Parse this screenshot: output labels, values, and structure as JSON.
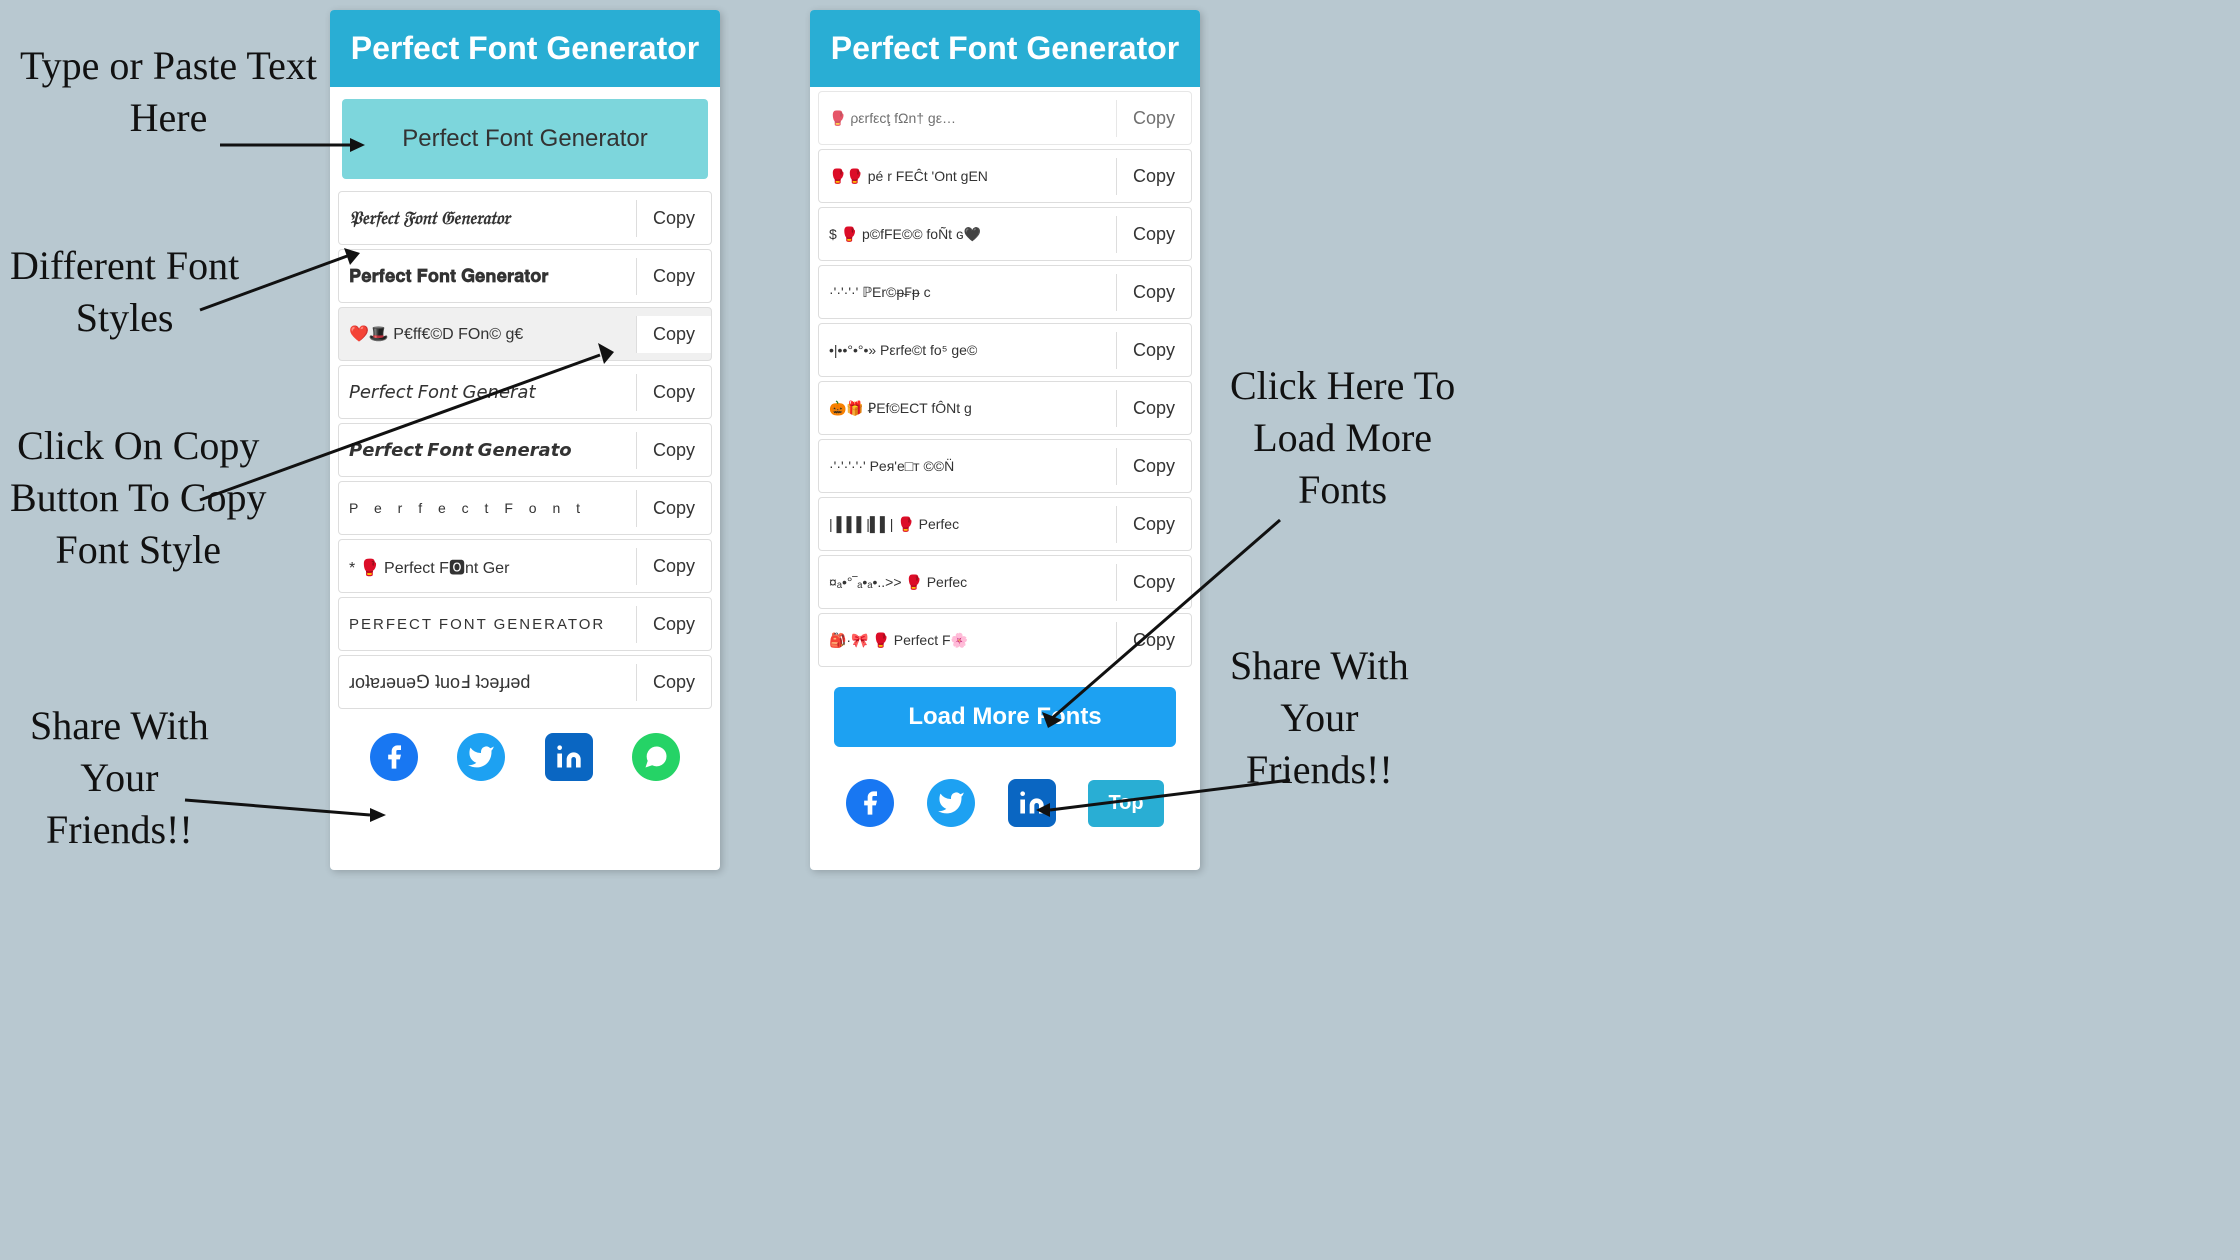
{
  "app": {
    "title": "Perfect Font Generator",
    "input_placeholder": "Perfect Font Generator"
  },
  "annotations": {
    "type_paste": "Type or Paste Text\nHere",
    "diff_fonts": "Different Font\nStyles",
    "click_copy": "Click On Copy\nButton To Copy\nFont Style",
    "share": "Share With\nYour\nFriends!!",
    "load_more": "Click Here To\nLoad More\nFonts",
    "share2": "Share With\nYour\nFriends!!"
  },
  "left_panel": {
    "header": "Perfect Font Generator",
    "input_value": "Perfect Font Generator",
    "font_rows": [
      {
        "id": 1,
        "text": "𝔓𝔢𝔯𝔣𝔢𝔠𝔱 𝔉𝔬𝔫𝔱 𝔊𝔢𝔫𝔢𝔯𝔞𝔱𝔬𝔯",
        "copy": "Copy",
        "style": "fraktur"
      },
      {
        "id": 2,
        "text": "𝐏𝐞𝐫𝐟𝐞𝐜𝐭 𝐅𝐨𝐧𝐭 𝐆𝐞𝐧𝐞𝐫𝐚𝐭𝐨𝐫",
        "copy": "Copy",
        "style": "bold"
      },
      {
        "id": 3,
        "text": "❤️🎩 P€ff€©D FOn© g€",
        "copy": "Copy",
        "style": "emoji"
      },
      {
        "id": 4,
        "text": "𝘗𝘦𝘳𝘧𝘦𝘤𝘵 𝘍𝘰𝘯𝘵 𝘎𝘦𝘯𝘦𝘳𝘢𝘵",
        "copy": "Copy",
        "style": "italic"
      },
      {
        "id": 5,
        "text": "𝙋𝙚𝙧𝙛𝙚𝙘𝙩 𝙁𝙤𝙣𝙩 𝙂𝙚𝙣𝙚𝙧𝙖𝙩𝙤",
        "copy": "Copy",
        "style": "bold-italic"
      },
      {
        "id": 6,
        "text": "Perfect Font Generator",
        "copy": "Copy",
        "style": "spaced"
      },
      {
        "id": 7,
        "text": "* 🥊 Perfect Fónt Ger",
        "copy": "Copy",
        "style": "emoji2"
      },
      {
        "id": 8,
        "text": "PERFECT FONT GENERATOR",
        "copy": "Copy",
        "style": "caps"
      },
      {
        "id": 9,
        "text": "ɹoʇɐɹǝuǝ⅁ ʇuoℲ ʇɔǝɟɹǝd",
        "copy": "Copy",
        "style": "flip"
      }
    ],
    "social": {
      "facebook": "f",
      "twitter": "t",
      "linkedin": "in",
      "whatsapp": "w"
    }
  },
  "right_panel": {
    "header": "Perfect Font Generator",
    "input_value": "Perfect Font Generator",
    "font_rows": [
      {
        "id": 1,
        "text": "p€ɾFEĈt 'Ont gEN",
        "copy": "Copy",
        "style": "special1"
      },
      {
        "id": 2,
        "text": "$ 🥊 p©fFE©© foÑt ɢ🖤",
        "copy": "Copy",
        "style": "special2"
      },
      {
        "id": 3,
        "text": "·'·'·'·' ℙEr©ᵽ₣ᵽ c",
        "copy": "Copy",
        "style": "special3"
      },
      {
        "id": 4,
        "text": "•|••°•°•» Pεrfe©t fo⁵ ge©",
        "copy": "Copy",
        "style": "special4"
      },
      {
        "id": 5,
        "text": "🎃🎁 ꝐEf©ECT fÔNt g",
        "copy": "Copy",
        "style": "special5"
      },
      {
        "id": 6,
        "text": "·'·'·'·'·' Pея'е□т ©©N̈",
        "copy": "Copy",
        "style": "special6"
      },
      {
        "id": 7,
        "text": "| 🥊 Perfec",
        "copy": "Copy",
        "style": "barcode"
      },
      {
        "id": 8,
        "text": "¤ₐ•°‾ₐ•ₐ•..>> 🥊 Perfec",
        "copy": "Copy",
        "style": "special7"
      },
      {
        "id": 9,
        "text": "🎒·🎀 🥊 Perfect F🌸",
        "copy": "Copy",
        "style": "special8"
      }
    ],
    "load_more": "Load More Fonts",
    "top_btn": "Top",
    "social": {
      "facebook": "f",
      "twitter": "t",
      "linkedin": "in"
    }
  }
}
